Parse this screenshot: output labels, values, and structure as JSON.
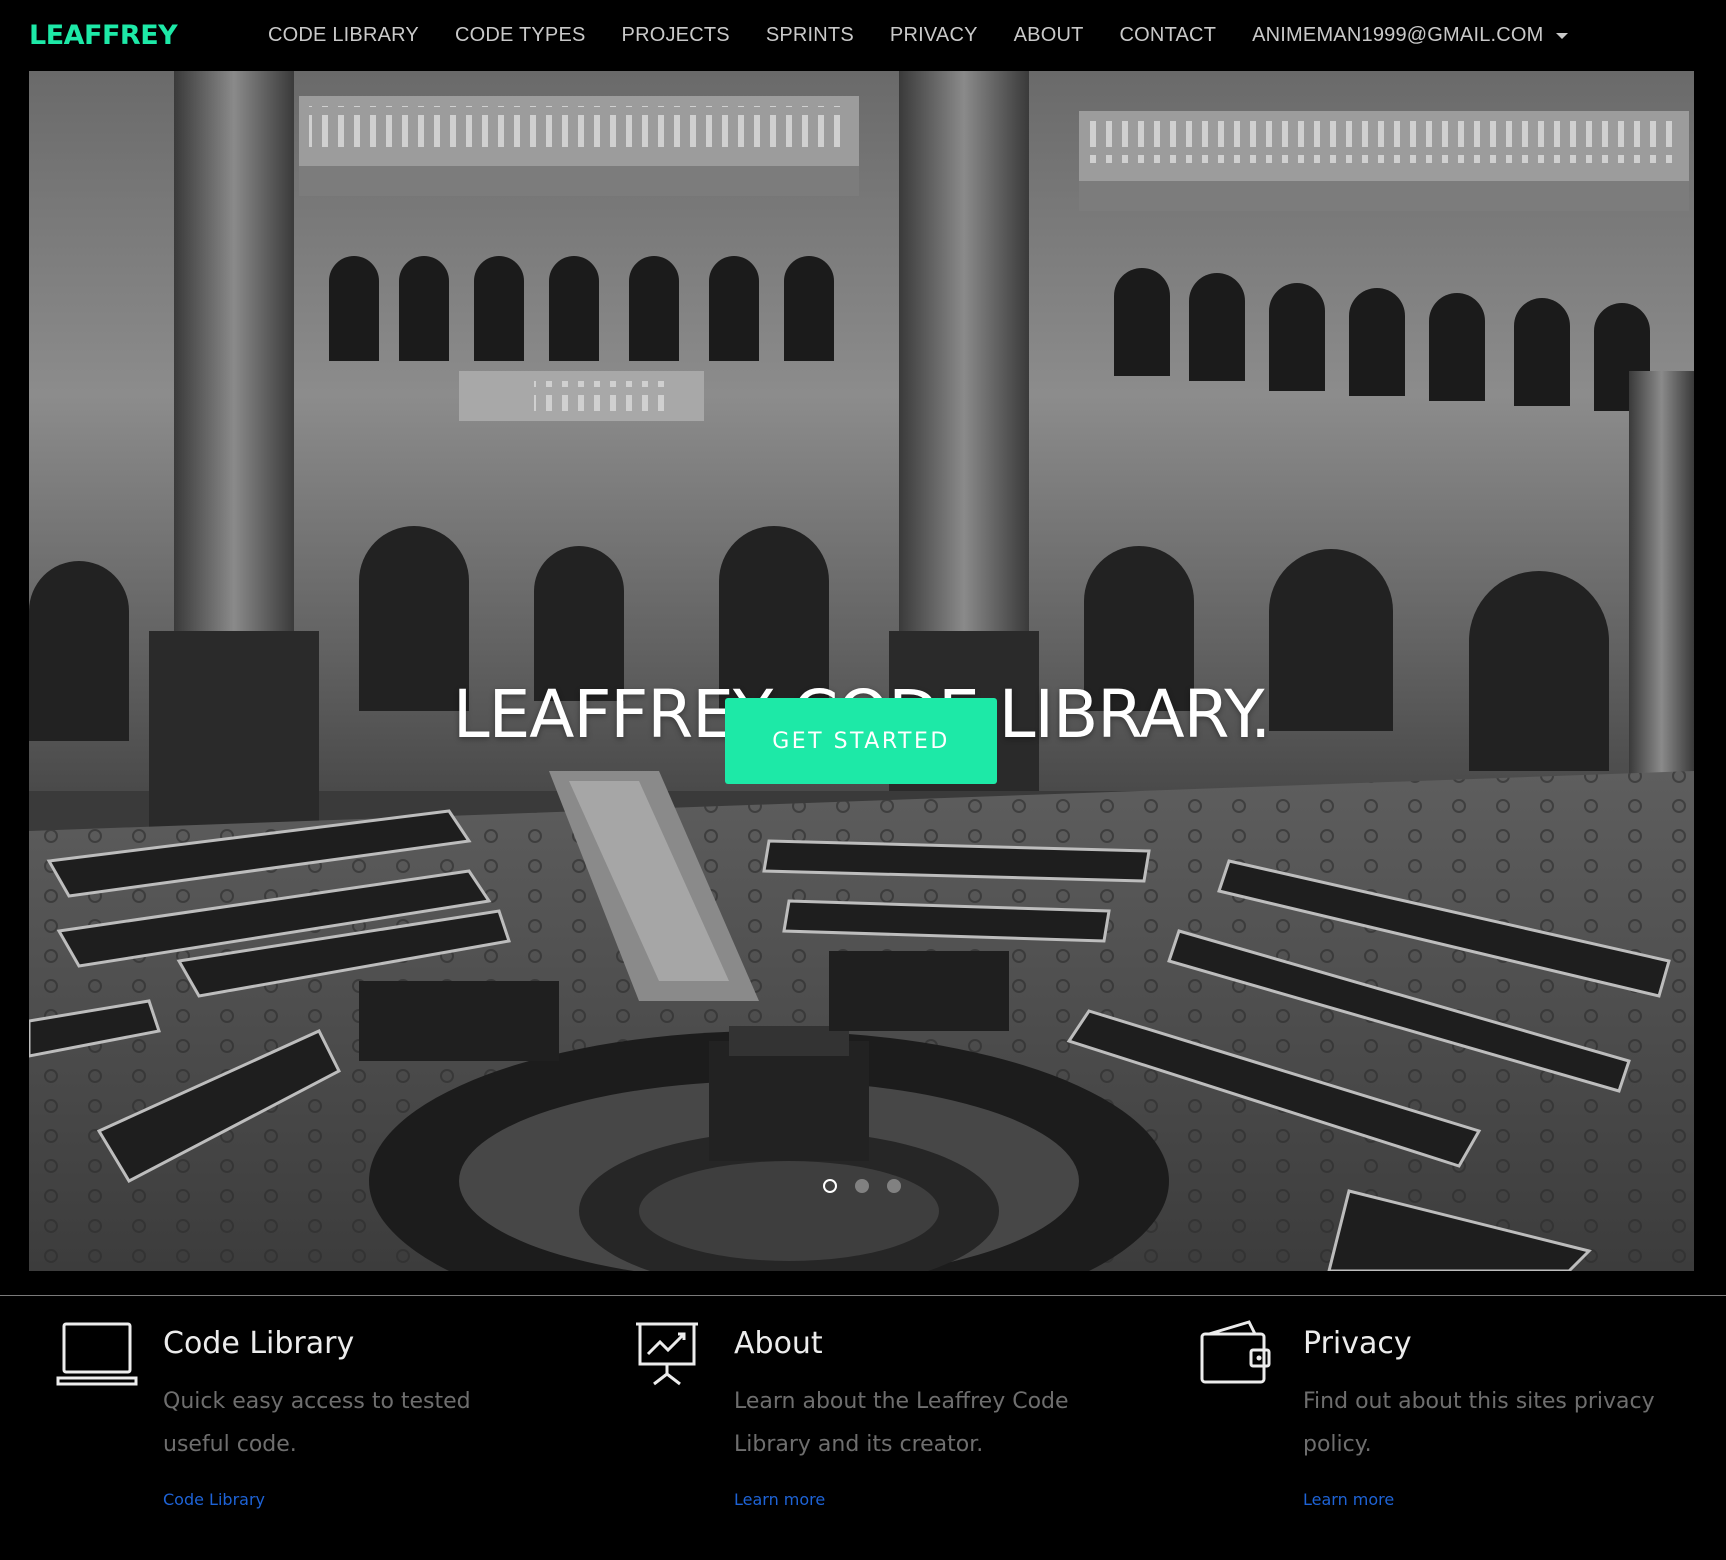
{
  "colors": {
    "accent": "#1de9a7",
    "link": "#1e63d6",
    "background": "#000000",
    "nav_text": "#c9c9c9"
  },
  "navbar": {
    "brand": "LEAFFREY",
    "links": [
      "CODE LIBRARY",
      "CODE TYPES",
      "PROJECTS",
      "SPRINTS",
      "PRIVACY",
      "ABOUT",
      "CONTACT"
    ],
    "user_menu": "ANIMEMAN1999@GMAIL.COM"
  },
  "hero": {
    "title": "LEAFFREY CODE LIBRARY.",
    "button": "GET STARTED",
    "slides": 3,
    "active_slide": 1
  },
  "features": [
    {
      "icon": "laptop-icon",
      "title": "Code Library",
      "description": "Quick easy access to tested useful code.",
      "link": "Code Library"
    },
    {
      "icon": "presentation-chart-icon",
      "title": "About",
      "description": "Learn about the Leaffrey Code Library and its creator.",
      "link": "Learn more"
    },
    {
      "icon": "wallet-icon",
      "title": "Privacy",
      "description": "Find out about this sites privacy policy.",
      "link": "Learn more"
    }
  ]
}
